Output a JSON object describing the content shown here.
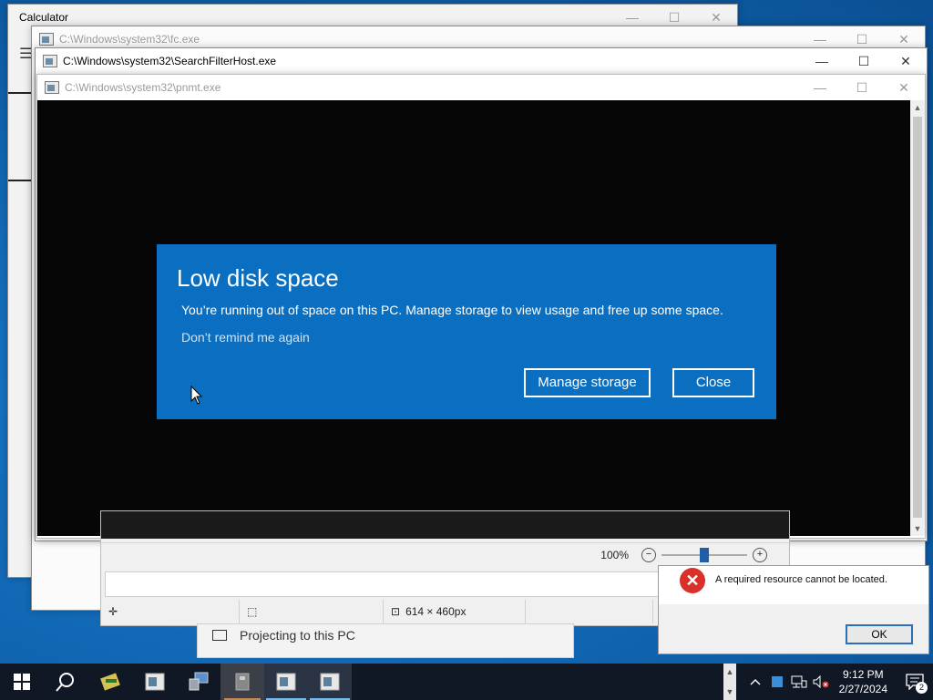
{
  "windows": {
    "calculator": {
      "title": "Calculator"
    },
    "fc": {
      "title": "C:\\Windows\\system32\\fc.exe"
    },
    "searchfilter": {
      "title": "C:\\Windows\\system32\\SearchFilterHost.exe"
    },
    "pnmt": {
      "title": "C:\\Windows\\system32\\pnmt.exe"
    },
    "controls": {
      "minimize": "—",
      "maximize": "☐",
      "close": "✕"
    }
  },
  "low_disk_dialog": {
    "title": "Low disk space",
    "body": "You’re running out of space on this PC. Manage storage to view usage and free up some space.",
    "dont_remind": "Don’t remind me again",
    "manage_button": "Manage storage",
    "close_button": "Close"
  },
  "paint": {
    "zoom_percent": "100%",
    "zoom_level": 0.5,
    "zoom_out": "−",
    "zoom_in": "+",
    "canvas_size": "614 × 460px"
  },
  "settings_back": {
    "label": "Projecting to this PC"
  },
  "error_dialog": {
    "message": "A required resource cannot be located.",
    "ok_button": "OK"
  },
  "taskbar": {
    "time": "9:12 PM",
    "date": "2/27/2024",
    "notification_count": "2"
  },
  "colors": {
    "dialog_blue": "#0a6fc1",
    "taskbar": "#101826",
    "error_red": "#d9302a"
  }
}
